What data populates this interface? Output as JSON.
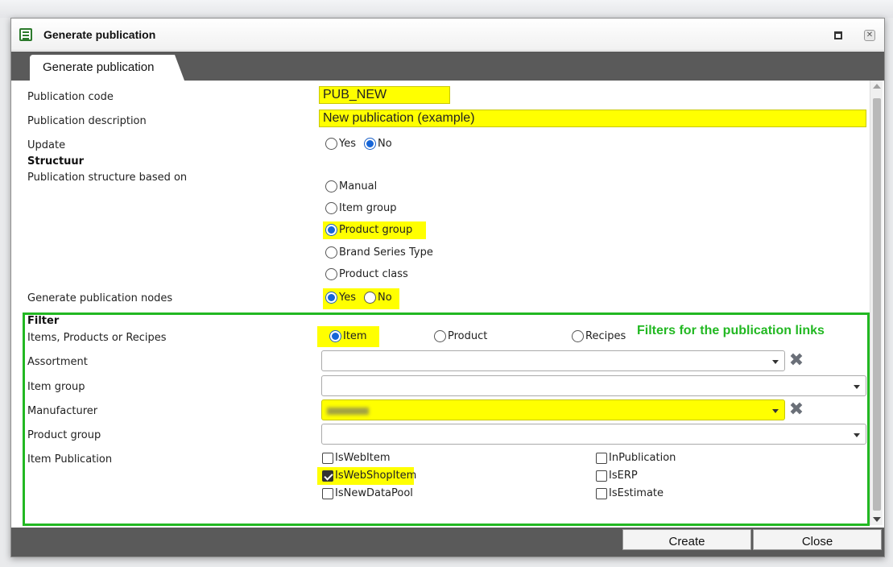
{
  "window": {
    "title": "Generate publication",
    "tab_label": "Generate publication"
  },
  "form": {
    "publication_code": {
      "label": "Publication code",
      "value": "PUB_NEW"
    },
    "publication_description": {
      "label": "Publication description",
      "value": "New publication (example)"
    },
    "update": {
      "label": "Update",
      "options": [
        "Yes",
        "No"
      ],
      "selected": "No"
    },
    "structure_section": "Structuur",
    "structure_based_on": {
      "label": "Publication structure based on",
      "options": [
        "Manual",
        "Item group",
        "Product group",
        "Brand Series Type",
        "Product class"
      ],
      "selected": "Product group"
    },
    "generate_nodes": {
      "label": "Generate publication nodes",
      "options": [
        "Yes",
        "No"
      ],
      "selected": "Yes"
    },
    "filter_section": "Filter",
    "filter_note": "Filters for the publication links",
    "items_products_recipes": {
      "label": "Items, Products or Recipes",
      "options": [
        "Item",
        "Product",
        "Recipes"
      ],
      "selected": "Item"
    },
    "assortment": {
      "label": "Assortment",
      "value": ""
    },
    "item_group": {
      "label": "Item group",
      "value": ""
    },
    "manufacturer": {
      "label": "Manufacturer",
      "value": ""
    },
    "product_group": {
      "label": "Product group",
      "value": ""
    },
    "item_publication": {
      "label": "Item Publication",
      "checks": [
        {
          "label": "IsWebItem",
          "checked": false
        },
        {
          "label": "IsWebShopItem",
          "checked": true
        },
        {
          "label": "IsNewDataPool",
          "checked": false
        },
        {
          "label": "InPublication",
          "checked": false
        },
        {
          "label": "IsERP",
          "checked": false
        },
        {
          "label": "IsEstimate",
          "checked": false
        }
      ]
    }
  },
  "footer": {
    "create_label": "Create",
    "close_label": "Close"
  },
  "colors": {
    "highlight": "#ffff00",
    "filter_border": "#22b822",
    "chrome_dark": "#5a5a5a",
    "radio_selected": "#1565d8"
  },
  "icons": {
    "app": "list-document-icon",
    "clear": "clear-x-icon",
    "dropdown": "chevron-down-icon"
  }
}
